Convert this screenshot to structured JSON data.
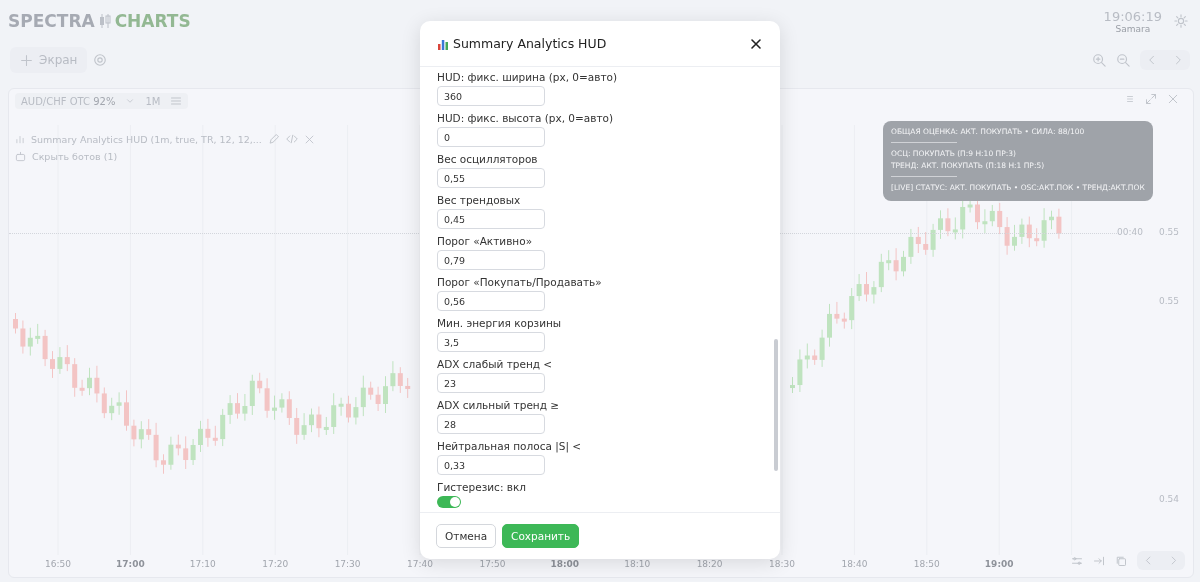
{
  "header": {
    "logo_left": "SPECTRA",
    "logo_right": "CHARTS",
    "clock": "19:06:19",
    "city": "Samara"
  },
  "toolbar": {
    "add_button": "Экран"
  },
  "chart": {
    "symbol": "AUD/CHF OTC",
    "payout": "92%",
    "timeframe": "1M",
    "indicator": {
      "label": "Summary Analytics HUD (1m, true, TR, 12, 12,...",
      "hide_bots": "Скрыть ботов (1)"
    },
    "hud": {
      "lines": [
        {
          "kind": "line",
          "text": "ОБЩАЯ ОЦЕНКА: АКТ. ПОКУПАТЬ • СИЛА: 88/100"
        },
        {
          "kind": "divider"
        },
        {
          "kind": "line",
          "text": "ОСЦ: ПОКУПАТЬ (П:9 Н:10 ПР:3)"
        },
        {
          "kind": "line",
          "text": "ТРЕНД: АКТ. ПОКУПАТЬ (П:18 Н:1 ПР:5)"
        },
        {
          "kind": "divider"
        },
        {
          "kind": "line",
          "text": "[LIVE] СТАТУС: АКТ. ПОКУПАТЬ • OSC:АКТ.ПОК • ТРЕНД:АКТ.ПОК"
        }
      ]
    },
    "countdown": "00:40",
    "price_labels": [
      "0.55",
      "0.55",
      "0.54"
    ],
    "time_labels": [
      {
        "text": "16:50",
        "major": false
      },
      {
        "text": "17:00",
        "major": true
      },
      {
        "text": "17:10",
        "major": false
      },
      {
        "text": "17:20",
        "major": false
      },
      {
        "text": "17:30",
        "major": false
      },
      {
        "text": "17:40",
        "major": false
      },
      {
        "text": "17:50",
        "major": false
      },
      {
        "text": "18:00",
        "major": true
      },
      {
        "text": "18:10",
        "major": false
      },
      {
        "text": "18:20",
        "major": false
      },
      {
        "text": "18:30",
        "major": false
      },
      {
        "text": "18:40",
        "major": false
      },
      {
        "text": "18:50",
        "major": false
      },
      {
        "text": "19:00",
        "major": true
      }
    ]
  },
  "dialog": {
    "title": "Summary Analytics HUD",
    "fields": [
      {
        "kind": "input",
        "label": "HUD: фикс. ширина (px, 0=авто)",
        "value": "360"
      },
      {
        "kind": "input",
        "label": "HUD: фикс. высота (px, 0=авто)",
        "value": "0"
      },
      {
        "kind": "input",
        "label": "Вес осцилляторов",
        "value": "0,55"
      },
      {
        "kind": "input",
        "label": "Вес трендовых",
        "value": "0,45"
      },
      {
        "kind": "input",
        "label": "Порог «Активно»",
        "value": "0,79"
      },
      {
        "kind": "input",
        "label": "Порог «Покупать/Продавать»",
        "value": "0,56"
      },
      {
        "kind": "input",
        "label": "Мин. энергия корзины",
        "value": "3,5"
      },
      {
        "kind": "input",
        "label": "ADX слабый тренд <",
        "value": "23"
      },
      {
        "kind": "input",
        "label": "ADX сильный тренд ≥",
        "value": "28"
      },
      {
        "kind": "input",
        "label": "Нейтральная полоса |S| <",
        "value": "0,33"
      },
      {
        "kind": "toggle",
        "label": "Гистерезис: вкл",
        "on": true
      }
    ],
    "cancel": "Отмена",
    "save": "Сохранить"
  }
}
